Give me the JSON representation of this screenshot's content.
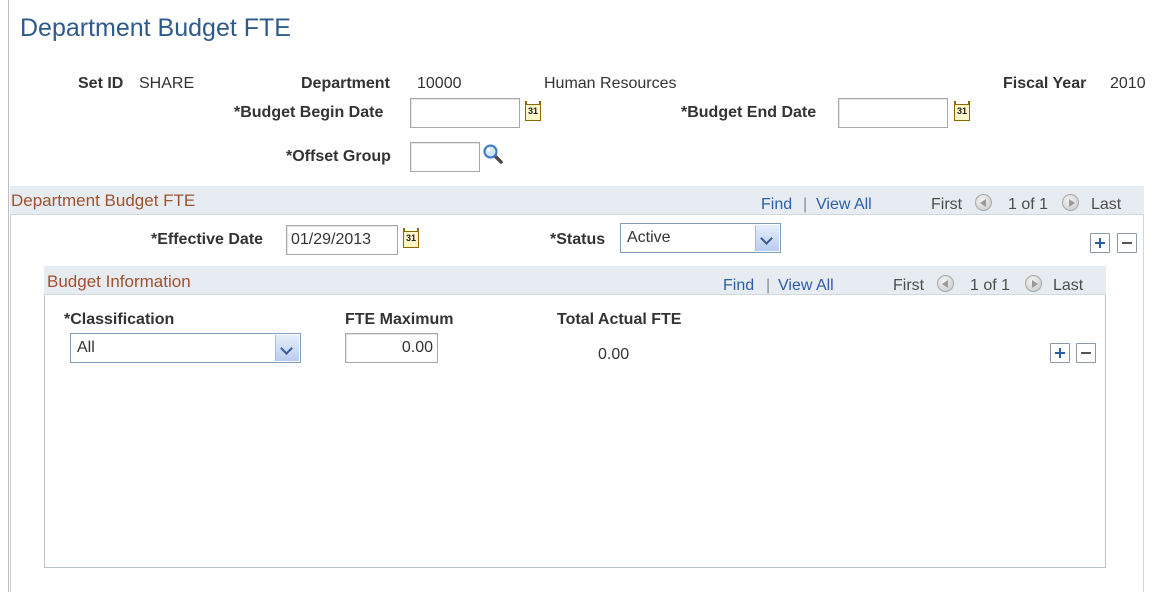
{
  "page": {
    "title": "Department Budget FTE"
  },
  "header": {
    "setid_label": "Set ID",
    "setid_value": "SHARE",
    "department_label": "Department",
    "department_value": "10000",
    "department_name": "Human Resources",
    "fiscal_year_label": "Fiscal Year",
    "fiscal_year_value": "2010",
    "budget_begin_label": "*Budget Begin Date",
    "budget_begin_value": "",
    "budget_end_label": "*Budget End Date",
    "budget_end_value": "",
    "offset_group_label": "*Offset Group",
    "offset_group_value": ""
  },
  "grid1": {
    "title": "Department Budget FTE",
    "find": "Find",
    "separator": "|",
    "view_all": "View All",
    "first": "First",
    "count": "1 of 1",
    "last": "Last",
    "effective_date_label": "*Effective Date",
    "effective_date_value": "01/29/2013",
    "status_label": "*Status",
    "status_value": "Active"
  },
  "grid2": {
    "title": "Budget Information",
    "find": "Find",
    "separator": "|",
    "view_all": "View All",
    "first": "First",
    "count": "1 of 1",
    "last": "Last",
    "col_classification": "*Classification",
    "col_fte_max": "FTE Maximum",
    "col_total_actual": "Total Actual FTE",
    "row": {
      "classification": "All",
      "fte_max": "0.00",
      "total_actual": "0.00"
    }
  },
  "icons": {
    "calendar": "calendar-icon",
    "calendar_text": "31",
    "search": "search-icon",
    "prev": "prev-arrow-icon",
    "next": "next-arrow-icon",
    "add": "plus-icon",
    "delete": "minus-icon",
    "dropdown": "chevron-down-icon"
  },
  "colors": {
    "title": "#2e5a8c",
    "grid_title": "#a0522d",
    "link": "#2d5ea8",
    "grid_bar": "#e6ecf2"
  }
}
